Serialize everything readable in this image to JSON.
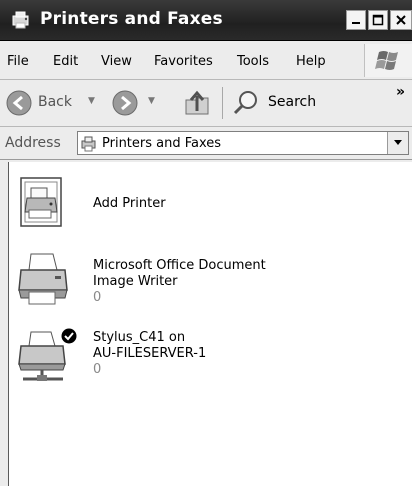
{
  "window": {
    "title": "Printers and Faxes",
    "buttons": {
      "minimize": "_",
      "maximize": "□",
      "close": "×"
    }
  },
  "menu": {
    "items": [
      "File",
      "Edit",
      "View",
      "Favorites",
      "Tools",
      "Help"
    ]
  },
  "toolbar": {
    "back_label": "Back",
    "search_label": "Search",
    "overflow": "»"
  },
  "address": {
    "label": "Address",
    "value": "Printers and Faxes"
  },
  "printers": [
    {
      "name_line1": "Add Printer",
      "name_line2": "",
      "jobs": "",
      "icon": "add-printer-icon"
    },
    {
      "name_line1": "Microsoft Office Document",
      "name_line2": "Image Writer",
      "jobs": "0",
      "icon": "printer-icon"
    },
    {
      "name_line1": "Stylus_C41 on",
      "name_line2": "AU-FILESERVER-1",
      "jobs": "0",
      "icon": "network-printer-default-icon"
    }
  ],
  "colors": {
    "titlebar": "#2a2a2a",
    "title_text": "#ffffff",
    "chrome": "#ececec"
  }
}
